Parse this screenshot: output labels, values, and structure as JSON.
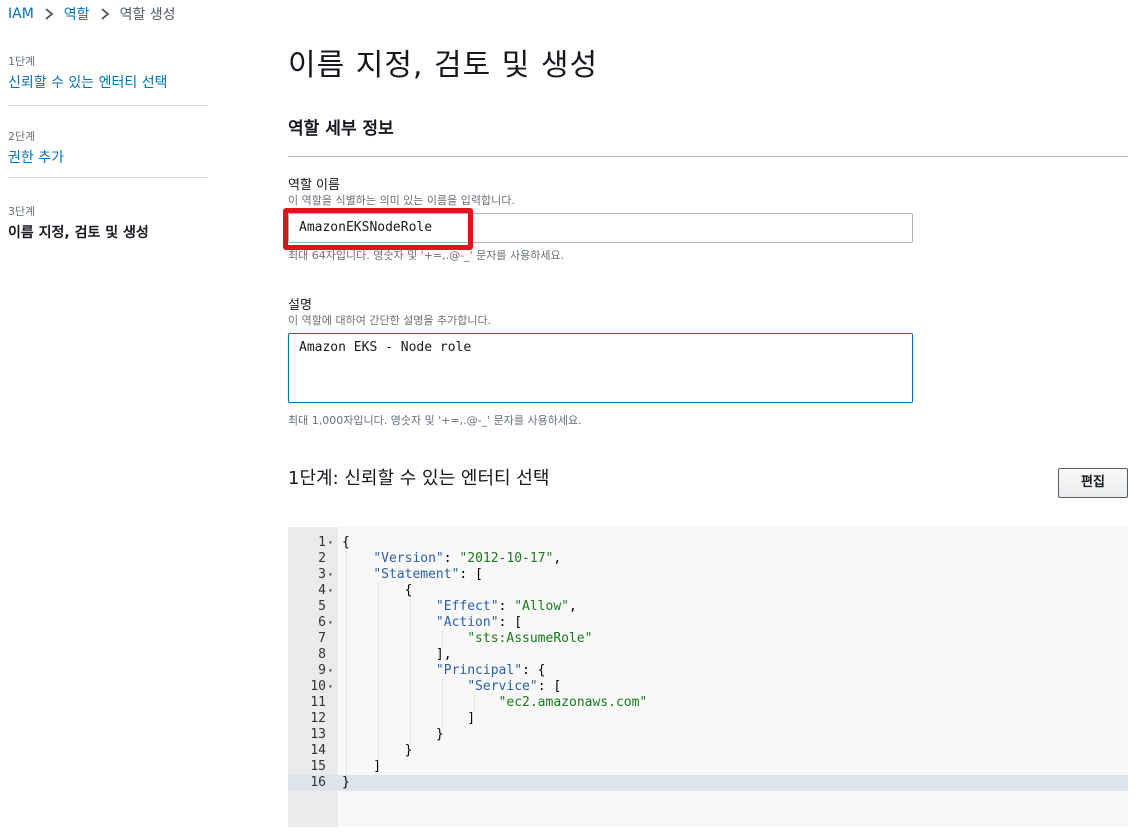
{
  "breadcrumb": {
    "root": "IAM",
    "parent": "역할",
    "current": "역할 생성"
  },
  "steps": [
    {
      "num": "1단계",
      "title": "신뢰할 수 있는 엔터티 선택"
    },
    {
      "num": "2단계",
      "title": "권한 추가"
    },
    {
      "num": "3단계",
      "title": "이름 지정, 검토 및 생성"
    }
  ],
  "page_title": "이름 지정, 검토 및 생성",
  "role_details": {
    "heading": "역할 세부 정보",
    "name_label": "역할 이름",
    "name_desc": "이 역할을 식별하는 의미 있는 이름을 입력합니다.",
    "name_value": "AmazonEKSNodeRole",
    "name_hint": "최대 64자입니다. 영숫자 및 '+=,.@-_' 문자를 사용하세요.",
    "desc_label": "설명",
    "desc_desc": "이 역할에 대하여 간단한 설명을 추가합니다.",
    "desc_value": "Amazon EKS - Node role",
    "desc_hint": "최대 1,000자입니다. 영숫자 및 '+=,.@-_' 문자를 사용하세요."
  },
  "step1": {
    "heading": "1단계: 신뢰할 수 있는 엔터티 선택",
    "edit_label": "편집"
  },
  "code": {
    "line_numbers": [
      "1",
      "2",
      "3",
      "4",
      "5",
      "6",
      "7",
      "8",
      "9",
      "10",
      "11",
      "12",
      "13",
      "14",
      "15",
      "16"
    ],
    "lines": [
      "{",
      "    \"Version\": \"2012-10-17\",",
      "    \"Statement\": [",
      "        {",
      "            \"Effect\": \"Allow\",",
      "            \"Action\": [",
      "                \"sts:AssumeRole\"",
      "            ],",
      "            \"Principal\": {",
      "                \"Service\": [",
      "                    \"ec2.amazonaws.com\"",
      "                ]",
      "            }",
      "        }",
      "    ]",
      "}"
    ]
  },
  "colors": {
    "link": "#0073bb",
    "highlight": "#e0131b",
    "json_key": "#2c5ea8",
    "json_string": "#1a7a1a"
  }
}
